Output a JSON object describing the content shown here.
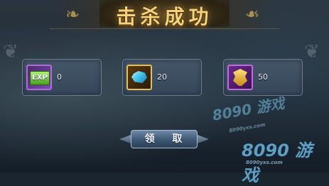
{
  "dialog": {
    "title": "击杀成功",
    "claim_label": "领 取"
  },
  "rewards": [
    {
      "name": "exp",
      "icon": "exp-icon",
      "badge": "EXP",
      "count": "0"
    },
    {
      "name": "gem",
      "icon": "gem-icon",
      "count": "20"
    },
    {
      "name": "armor",
      "icon": "armor-icon",
      "count": "50"
    }
  ],
  "watermark": {
    "logo_mid": "8090 游戏",
    "url_mid": "8090yxs.com",
    "logo_bottom": "8090 游戏",
    "url_bottom": "8090yxs.com"
  },
  "colors": {
    "title": "#f6d27a",
    "slot_bg": "#3e4f62",
    "exp_border": "#b36bd9",
    "gem_border": "#e8c24a",
    "armor_border": "#c26be0"
  }
}
